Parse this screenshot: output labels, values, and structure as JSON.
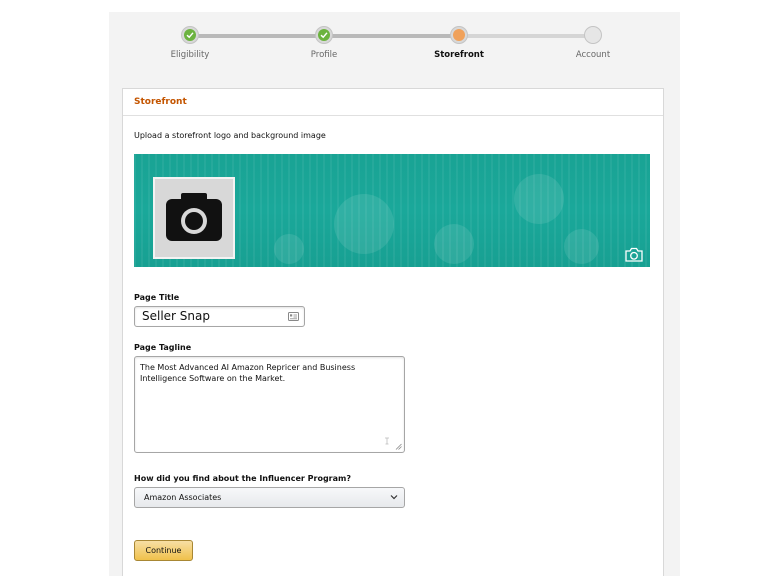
{
  "steps": [
    {
      "label": "Eligibility",
      "state": "done"
    },
    {
      "label": "Profile",
      "state": "done"
    },
    {
      "label": "Storefront",
      "state": "current"
    },
    {
      "label": "Account",
      "state": "todo"
    }
  ],
  "card": {
    "title": "Storefront",
    "description": "Upload a storefront logo and background image"
  },
  "banner": {
    "color": "#19a394",
    "logo_icon": "camera-icon",
    "background_upload_icon": "camera-icon"
  },
  "page_title": {
    "label": "Page Title",
    "value": "Seller Snap"
  },
  "page_tagline": {
    "label": "Page Tagline",
    "value": "The Most Advanced AI Amazon Repricer and Business Intelligence Software on the Market."
  },
  "source": {
    "label": "How did you find about the Influencer Program?",
    "selected": "Amazon Associates"
  },
  "actions": {
    "continue_label": "Continue"
  },
  "colors": {
    "accent_orange": "#c45500",
    "done_green": "#6cb33f",
    "current_orange": "#f0a15a",
    "button_yellow": "#f0c14b"
  }
}
